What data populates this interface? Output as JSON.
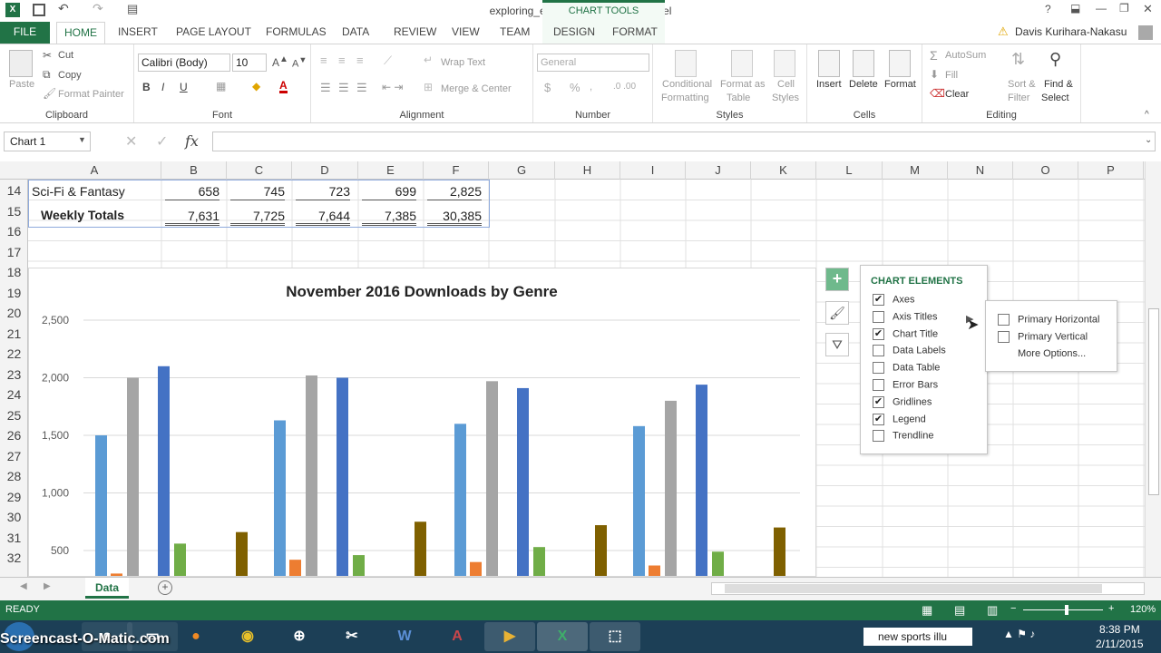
{
  "window": {
    "title": "exploring_e03_grader_h1.xlsx - Excel",
    "chart_tools": "CHART TOOLS",
    "user": "Davis Kurihara-Nakasu"
  },
  "tabs": [
    "FILE",
    "HOME",
    "INSERT",
    "PAGE LAYOUT",
    "FORMULAS",
    "DATA",
    "REVIEW",
    "VIEW",
    "TEAM",
    "DESIGN",
    "FORMAT"
  ],
  "ribbon": {
    "clipboard": {
      "paste": "Paste",
      "cut": "Cut",
      "copy": "Copy",
      "format_painter": "Format Painter",
      "label": "Clipboard"
    },
    "font": {
      "name": "Calibri (Body)",
      "size": "10",
      "label": "Font"
    },
    "alignment": {
      "wrap": "Wrap Text",
      "merge": "Merge & Center",
      "label": "Alignment"
    },
    "number": {
      "format": "General",
      "currency": "$",
      "percent": "%",
      "label": "Number"
    },
    "styles": {
      "conditional": "Conditional",
      "formatting": "Formatting",
      "format_as": "Format as",
      "table": "Table",
      "cell": "Cell",
      "styles_word": "Styles",
      "label": "Styles"
    },
    "cells": {
      "insert": "Insert",
      "delete": "Delete",
      "format": "Format",
      "label": "Cells"
    },
    "editing": {
      "autosum": "AutoSum",
      "fill": "Fill",
      "clear": "Clear",
      "sort": "Sort &",
      "filter": "Filter",
      "find": "Find &",
      "select": "Select",
      "label": "Editing"
    }
  },
  "formula": {
    "namebox": "Chart 1",
    "fx": "fx"
  },
  "columns": [
    "A",
    "B",
    "C",
    "D",
    "E",
    "F",
    "G",
    "H",
    "I",
    "J",
    "K",
    "L",
    "M",
    "N",
    "O",
    "P"
  ],
  "rows": [
    "14",
    "15",
    "16",
    "17",
    "18",
    "19",
    "20",
    "21",
    "22",
    "23",
    "24",
    "25",
    "26",
    "27",
    "28",
    "29",
    "30",
    "31",
    "32"
  ],
  "row14": [
    "Sci-Fi & Fantasy",
    "658",
    "745",
    "723",
    "699",
    "2,825"
  ],
  "row15": [
    "Weekly Totals",
    "7,631",
    "7,725",
    "7,644",
    "7,385",
    "30,385"
  ],
  "chart_data": {
    "type": "bar",
    "title": "November 2016 Downloads by Genre",
    "ylim": [
      0,
      2500
    ],
    "yticks": [
      "2,500",
      "2,000",
      "1,500",
      "1,000",
      "500"
    ],
    "grid": true,
    "colors": [
      "#5b9bd5",
      "#ed7d31",
      "#a5a5a5",
      "#4472c4",
      "#70ad47",
      "#7f6000"
    ],
    "groups": [
      [
        1500,
        300,
        2000,
        2100,
        560,
        660
      ],
      [
        1630,
        420,
        2020,
        2000,
        460,
        750
      ],
      [
        1600,
        400,
        1970,
        1910,
        530,
        720
      ],
      [
        1580,
        370,
        1800,
        1940,
        490,
        700
      ]
    ]
  },
  "chart_elements": {
    "title": "CHART ELEMENTS",
    "items": [
      {
        "label": "Axes",
        "checked": true
      },
      {
        "label": "Axis Titles",
        "checked": false
      },
      {
        "label": "Chart Title",
        "checked": true
      },
      {
        "label": "Data Labels",
        "checked": false
      },
      {
        "label": "Data Table",
        "checked": false
      },
      {
        "label": "Error Bars",
        "checked": false
      },
      {
        "label": "Gridlines",
        "checked": true
      },
      {
        "label": "Legend",
        "checked": true
      },
      {
        "label": "Trendline",
        "checked": false
      }
    ],
    "sub": {
      "primary_horizontal": "Primary Horizontal",
      "primary_vertical": "Primary Vertical",
      "more": "More Options..."
    }
  },
  "sheet": {
    "tab": "Data",
    "status": "READY",
    "zoom": "120%"
  },
  "taskbar": {
    "search": "new sports illu",
    "time": "8:38 PM",
    "date": "2/11/2015",
    "watermark": "Screencast-O-Matic.com"
  }
}
